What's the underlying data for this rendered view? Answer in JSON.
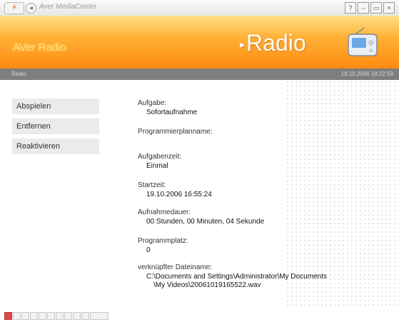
{
  "window": {
    "title": "Aver MediaCenter",
    "controls": [
      {
        "name": "help-button",
        "glyph": "?"
      },
      {
        "name": "minimize-button",
        "glyph": "–"
      },
      {
        "name": "maximize-button",
        "glyph": "▭"
      },
      {
        "name": "close-button",
        "glyph": "×"
      }
    ]
  },
  "banner": {
    "left_text": "AVer Radio",
    "title_bullet": "▸",
    "title": "Radio"
  },
  "status": {
    "left": "Radio",
    "right": "19.10.2006 18:22:59"
  },
  "sidebar": {
    "items": [
      {
        "label": "Abspielen"
      },
      {
        "label": "Entfernen"
      },
      {
        "label": "Reaktivieren"
      }
    ]
  },
  "details": {
    "aufgabe_label": "Aufgabe:",
    "aufgabe_value": "Sofortaufnahme",
    "plan_label": "Programmierplanname:",
    "plan_value": "",
    "zeit_label": "Aufgabenzeit:",
    "zeit_value": "Einmal",
    "start_label": "Startzeit:",
    "start_value": "19.10.2006 16:55:24",
    "dauer_label": "Aufnahmedauer:",
    "dauer_value": "00 Stunden, 00 Minuten, 04 Sekunde",
    "platz_label": "Programmplatz:",
    "platz_value": "0",
    "datei_label": "verknüpfter Dateiname:",
    "datei_line1": "C:\\Documents and Settings\\Administrator\\My Documents",
    "datei_line2": "\\My Videos\\20061019165522.wav"
  },
  "colors": {
    "banner_top": "#ffe089",
    "banner_bottom": "#ff8a0e",
    "statusbar": "#7e7e7e"
  }
}
